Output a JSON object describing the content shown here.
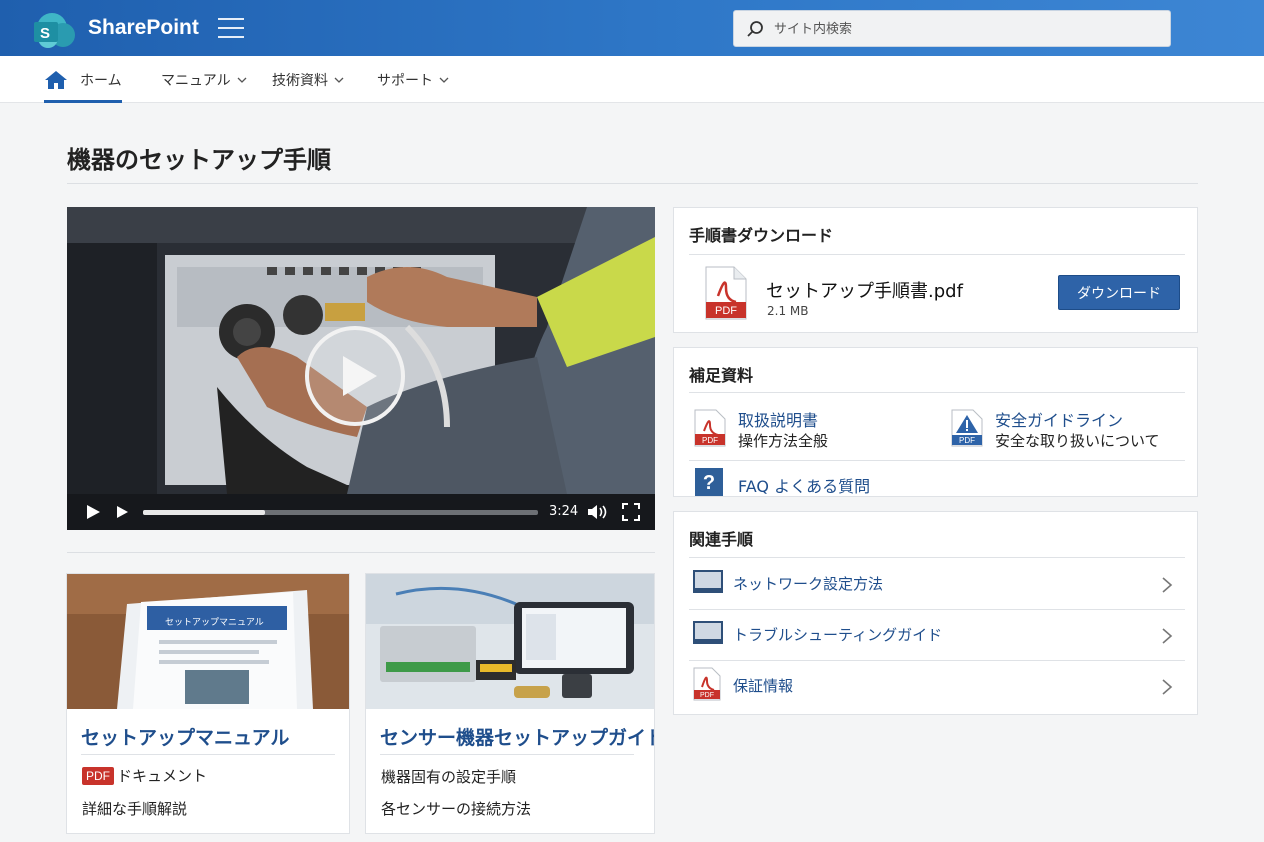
{
  "app": {
    "brand": "SharePoint"
  },
  "search": {
    "placeholder": "サイト内検索"
  },
  "nav": {
    "items": [
      {
        "label": "ホーム",
        "icon": "home-icon"
      },
      {
        "label": "マニュアル",
        "icon": "chevron-down-icon"
      },
      {
        "label": "技術資料",
        "icon": "chevron-down-icon"
      },
      {
        "label": "サポート",
        "icon": "chevron-down-icon"
      }
    ]
  },
  "page": {
    "title": "機器のセットアップ手順"
  },
  "video": {
    "duration": "3:24",
    "progress": 0.31
  },
  "cards": [
    {
      "image_label": "セットアップマニュアル",
      "title": "セットアップマニュアル",
      "badge": "PDF",
      "line1": "ドキュメント",
      "line2": "詳細な手順解説"
    },
    {
      "title": "センサー機器セットアップガイド",
      "line1": "機器固有の設定手順",
      "line2": "各センサーの接続方法"
    }
  ],
  "download_panel": {
    "title": "手順書ダウンロード",
    "file_name": "セットアップ手順書.pdf",
    "file_size": "2.1 MB",
    "file_badge": "PDF",
    "button_label": "ダウンロード"
  },
  "resources_panel": {
    "title": "補足資料",
    "items": [
      {
        "title": "取扱説明書",
        "subtitle": "操作方法全般",
        "icon": "pdf-icon",
        "badge": "PDF"
      },
      {
        "title": "安全ガイドライン",
        "subtitle": "安全な取り扱いについて",
        "icon": "warning-pdf-icon",
        "badge": "PDF"
      },
      {
        "title": "FAQ よくある質問",
        "icon": "question-icon"
      }
    ]
  },
  "related_panel": {
    "title": "関連手順",
    "items": [
      {
        "label": "ネットワーク設定方法",
        "icon": "monitor-icon"
      },
      {
        "label": "トラブルシューティングガイド",
        "icon": "monitor-icon"
      },
      {
        "label": "保証情報",
        "icon": "pdf-icon",
        "badge": "PDF"
      }
    ]
  },
  "colors": {
    "suite_bar": "#2f78c8",
    "link": "#1f4e8c",
    "button": "#2e63a8",
    "pdf_red": "#c8332b"
  }
}
